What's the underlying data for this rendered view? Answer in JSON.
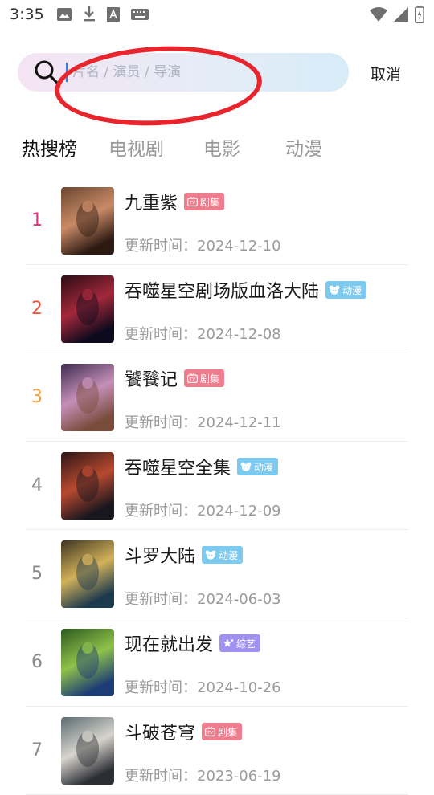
{
  "status_bar": {
    "time": "3:35",
    "icons": [
      "image-icon",
      "download-icon",
      "font-app-icon",
      "keyboard-icon",
      "wifi-icon",
      "signal-icon",
      "battery-icon"
    ]
  },
  "search": {
    "placeholder": "片名 / 演员 / 导演",
    "value": "",
    "cancel_label": "取消",
    "annotation_color": "#e8252d"
  },
  "tabs": [
    {
      "label": "热搜榜",
      "active": true
    },
    {
      "label": "电视剧",
      "active": false
    },
    {
      "label": "电影",
      "active": false
    },
    {
      "label": "动漫",
      "active": false
    }
  ],
  "badge_colors": {
    "剧集": "#ee7d8e",
    "动漫": "#7ccaf0",
    "综艺": "#a092f2"
  },
  "rank_colors": {
    "1": "#e8307d",
    "2": "#ee5436",
    "3": "#f3a141",
    "default": "#8a8a8a"
  },
  "items": [
    {
      "rank": "1",
      "title": "九重紫",
      "badge": "剧集",
      "badge_icon": "tv-icon",
      "date_label": "更新时间：",
      "date": "2024-12-10",
      "poster_colors": [
        "#6b4630",
        "#c98a67",
        "#2c1a12"
      ]
    },
    {
      "rank": "2",
      "title": "吞噬星空剧场版血洛大陆",
      "badge": "动漫",
      "badge_icon": "bear-icon",
      "date_label": "更新时间：",
      "date": "2024-12-08",
      "poster_colors": [
        "#2a0c12",
        "#a3283b",
        "#0c0a1c"
      ]
    },
    {
      "rank": "3",
      "title": "饕餮记",
      "badge": "剧集",
      "badge_icon": "tv-icon",
      "date_label": "更新时间：",
      "date": "2024-12-11",
      "poster_colors": [
        "#3d2c4e",
        "#c58fb9",
        "#7a4a3a"
      ]
    },
    {
      "rank": "4",
      "title": "吞噬星空全集",
      "badge": "动漫",
      "badge_icon": "bear-icon",
      "date_label": "更新时间：",
      "date": "2024-12-09",
      "poster_colors": [
        "#2b1616",
        "#b8492f",
        "#18161f"
      ]
    },
    {
      "rank": "5",
      "title": "斗罗大陆",
      "badge": "动漫",
      "badge_icon": "bear-icon",
      "date_label": "更新时间：",
      "date": "2024-06-03",
      "poster_colors": [
        "#3d3421",
        "#d2b15a",
        "#1c3a4d"
      ]
    },
    {
      "rank": "6",
      "title": "现在就出发",
      "badge": "综艺",
      "badge_icon": "star-icon",
      "date_label": "更新时间：",
      "date": "2024-10-26",
      "poster_colors": [
        "#2c5a1f",
        "#8fc14a",
        "#1c3c75"
      ]
    },
    {
      "rank": "7",
      "title": "斗破苍穹",
      "badge": "剧集",
      "badge_icon": "tv-icon",
      "date_label": "更新时间：",
      "date": "2023-06-19",
      "poster_colors": [
        "#5b6b72",
        "#d8d4cd",
        "#2b2e34"
      ]
    }
  ]
}
